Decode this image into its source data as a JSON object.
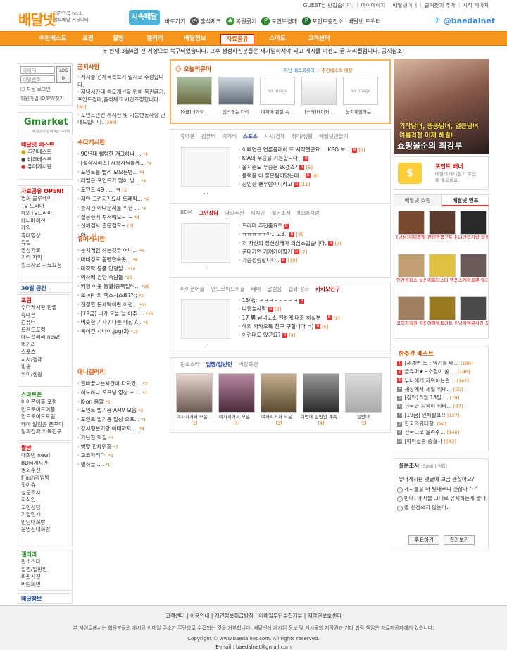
{
  "top_links": [
    "GUEST님 반갑습니다.",
    "마이페이지",
    "배달넷이니",
    "즐겨찾기 추가",
    "시작 페이지"
  ],
  "logo": {
    "text": "배달넷",
    "sub1": "대한민국 no.1",
    "sub2": "정보배달 커뮤니티",
    "badge": "시속배달"
  },
  "quicklinks": {
    "label": "바로가기",
    "items": [
      "출석체크",
      "복권긁기",
      "포인트경매",
      "포인트충전소",
      "배달넷 트위터!"
    ]
  },
  "twitter_handle": "@baedalnet",
  "nav": [
    "추천베스트",
    "포럼",
    "짤방",
    "갤러리",
    "배달정보",
    "자료공유",
    "스마트",
    "고객센터"
  ],
  "nav_active": "자료공유",
  "notice": "※ 현재 3월4일 전 게정으로 복구되었습니다. 그후 생성하신분들은 재가입하셔야 되고 게시물 이젠도 곧 처리될겁니다. 공지참조!",
  "login": {
    "id_placeholder": "아이디",
    "pw_placeholder": "비밀번호",
    "button": "LOG IN",
    "auto": "자동 로그인",
    "links": "회원가입 ID/PW찾기"
  },
  "gmarket": {
    "name": "Gmarket",
    "sub": "배달넷과 함께하는 G마켓"
  },
  "left_best": {
    "title": "배달넷 베스트",
    "items": [
      "추천베스트",
      "비추베스트",
      "유머게시판"
    ]
  },
  "left_share": {
    "title": "자료공유 OPEN!",
    "rows": [
      "영화 블루레이",
      "TV 드라마",
      "해외TV드라마",
      "애니메이션",
      "게임",
      "휴대영상",
      "유틸",
      "영상자료",
      "기타 자막",
      "링크자료 자료요청"
    ]
  },
  "left_30": "30일 공간",
  "left_forum": {
    "title": "포럼",
    "items": [
      "수다게시판 한줄",
      "휴대폰",
      "컴퓨터",
      "트랜드포럼",
      "애니갤러리 new!",
      "먹거리",
      "스포츠",
      "시사/경제",
      "방송",
      "취미/생활"
    ]
  },
  "left_smart": {
    "title": "스마트폰",
    "items": [
      "아이폰어플 포럼",
      "안드로이드어플",
      "안드로이드포럼",
      "테마 알림음 폰꾸미",
      "팁과강좌 카톡친구"
    ]
  },
  "left_jjal": {
    "title": "짤방",
    "items": [
      "대화방 new!",
      "BDM게시판",
      "영화추천",
      "Flash게임방",
      "핫이슈",
      "설문조사",
      "지식인",
      "고민상담",
      "기업인사",
      "만담대화방",
      "운영진대화방"
    ]
  },
  "left_gallery": {
    "title": "갤러리",
    "items": [
      "완소스타",
      "얼짱/일반인",
      "회원사진",
      "바탕화면"
    ]
  },
  "left_info": "배달정보",
  "notice_box": {
    "title": "공지사항",
    "items": [
      "게시물 전체목록보기 일시로 수정합니다.",
      "저녁시간대 속도개선을 위해 복권긁기,포인트경매,출석체크 시간조정합니다.",
      "포인트관련 게시판 및 기능변동사항 안내드립니다."
    ],
    "counts": [
      "[80]",
      "[80]",
      "[200]"
    ]
  },
  "free_board": {
    "title": "수다게시판",
    "items": [
      "90년대 썰렁한 개그하나 ...",
      "[철학시리즈] 사용자님들께...",
      "포인트를 빨리 모으는방...",
      "레벨은 포인트가 많이 쌓...",
      "포인트 49 ..... ㅋ",
      "저만 그런지? 요새 트래픽...",
      "송지선 아나운서를 위한 ...",
      "질문한거 투척해요~_~",
      "신체검사 결문검요~",
      "아~"
    ],
    "counts": [
      "*4",
      "*4",
      "*4",
      "*4",
      "*2",
      "*4",
      "*4",
      "*4",
      "[3]",
      "*1"
    ]
  },
  "humor_board": {
    "title": "유머게시판",
    "items": [
      "눈치게임 하는것두 어니...",
      "마네킹도 볼펜한속옷...",
      "마작막 등풀 인형탈..",
      "여자에 관란 속담들",
      "커핑 아웃 동결(중복일려...",
      "또 하나의 엑소시스트??;;",
      "진정한 돈세탁이란 이런...",
      "[19금] 내가 오늘 널 아주 ...",
      "비슷한 기사 / 다른 대상 /...",
      "목이긴 사나이.jpg(2)"
    ],
    "counts": [
      "*6",
      "*6",
      "*10",
      "*23",
      "*16",
      "*2",
      "*13",
      "*26",
      "*4",
      "*15"
    ]
  },
  "anime_gallery": {
    "title": "애니갤러리",
    "items": [
      "알바끝나는시간이 다되었...",
      "이노하나 오프닝 영상 + ...",
      "K-on 움짤",
      "포인트 벌기용 AMV 모음",
      "포인트 벌기용 일상 오프...",
      "강시형본기량 여태까지 ...",
      "가난한 덕질",
      "병맛 합체만화",
      "교코파티다.",
      "별하늘....."
    ],
    "counts": [
      "*2",
      "*2",
      "*5",
      "*3",
      "*1",
      "*4",
      "*3",
      "*7",
      "*1",
      "*1"
    ]
  },
  "today_humor": {
    "title": "오늘의유머",
    "links": [
      "지난 베스트유머",
      "추천베스트 예찰"
    ],
    "items": [
      "[9금]내가오...",
      "신박등는 다리",
      "여자에 관한 속...",
      "[스타]테이커...",
      "눈치게임하는..."
    ],
    "noimage": "No Image"
  },
  "tab_block1": {
    "tabs": [
      "휴대폰",
      "컴퓨터",
      "먹거리",
      "스포츠",
      "시사/경제",
      "취미/생활",
      "배달넷만들기"
    ],
    "active": "스포츠",
    "items": [
      "이빠연은 연론플레이 또 시작햇군요.!! KBO 보...",
      "KIA의 우승을 기원합니다!!",
      "올시즌도 우승은 sk겠죠?",
      "블랙을 아 좋은팀이었는데...",
      "잔인한 팬우람이니라고"
    ],
    "counts": [
      "[1]",
      "",
      "[5]",
      "[8]",
      "[11]"
    ]
  },
  "tab_block2": {
    "tabs": [
      "BDM",
      "고민상담",
      "영화추천",
      "지식인",
      "설문조사",
      "flash겜방"
    ],
    "active": "고민상담",
    "items": [
      "드라마 추천줌요!!",
      "ㅠㅠㅠㅠㅠ아.. 고3..",
      "저 자신의 정신상태가 의심스럽습니다.",
      "군대가면 가져가야할거",
      "가슴성형합니다.."
    ],
    "counts": [
      "",
      "[8]",
      "[3]",
      "[7]",
      "[10]"
    ]
  },
  "tab_block3": {
    "tabs": [
      "아이폰어플",
      "안드로이드어플",
      "테마",
      "알림음",
      "팁과 강좌",
      "카카오친구"
    ],
    "active": "카카오친구",
    "items": [
      "15여;; ㅋㅋㅋㅋㅋㅋㅋㅋ",
      "나랑놀사람",
      "17 男 남녀노소 편하게 대화 하실분~",
      "해외 카카오톡 친구 구합니다 =)",
      "이런대도 있군요?"
    ],
    "counts": [
      "",
      "[3]",
      "[2]",
      "[5]",
      "[4]"
    ]
  },
  "tab_block4": {
    "tabs": [
      "완소스타",
      "얼짱/일반인",
      "바탕화면"
    ],
    "active": "얼짱/일반인",
    "items": [
      "여자지거서 모은...",
      "여자지거서 모은...",
      "여자지거서 모은...",
      "이번에 일반인 계속...",
      "일반녀"
    ],
    "counts": [
      "[1]",
      "[1]",
      "[3]",
      "[4]",
      "[5]"
    ]
  },
  "ad_banner": {
    "line1": "키작남녀, 뚱뚱남녀, 얼큰남녀",
    "line1b": "여름걱정 이제 해결!",
    "line2": "쇼핑몰순의 최강루"
  },
  "point_banner": {
    "title": "포인트 배너",
    "sub": "배달넷 배너달고 포인트 쌓으세요."
  },
  "shop_tabs": [
    "배달넷 쇼핑",
    "배달넷 인포"
  ],
  "shop_items": [
    "[남성]새제품캐쥬얼슈즈",
    "현빈명품구두 판매율1위",
    "나만의가방 학생컬러3000",
    "인견원피스 늘씬한효과",
    "애프터스터 명품피아노",
    "스캐이트쁜 얼러겠어요",
    "코디지저권 지원기 사은품",
    "여혀빌트리트 휘파냅시",
    "남자얻분사진 모피면자"
  ],
  "week_best": {
    "title": "한주간 베스트",
    "items": [
      "[세계연 트 : 약기를 왜...",
      "금유머★~소질이 쏟 ...",
      "누나에게 자위하는걸...",
      "세상에서 제일 위대...",
      "[강좌] 5월 18일 ...",
      "천국과 지옥이 뒤바...",
      "[19금] 인체발표!!",
      "한국의위대함.",
      "천국으로 올려주...",
      "[하이실종 종결자"
    ],
    "counts": [
      "[180]",
      "[146]",
      "[167]",
      "[65]",
      "[79]",
      "[87]",
      "[127]",
      "[92]",
      "[140]",
      "[142]"
    ]
  },
  "survey": {
    "title": "설문조사",
    "subtitle": "(5point 적립)",
    "question": "유머게시판 댓글에 브금 괜찮아요?",
    "options": [
      "게시물을 더 빛내주니 괜찮다 ^^",
      "반대! 게시물 그대로 유지하는게 좋다.",
      "별 신경쓰지 않는다.."
    ],
    "vote": "투표하기",
    "result": "결과보기"
  },
  "footer": {
    "links": [
      "고객센터",
      "이용안내",
      "개인정보취급방침",
      "이메일무단수집거부",
      "저작권보호센터"
    ],
    "disclaimer": "본 사이트에서는 회원분들의 게시된 이메일 주소가 무단으로 수집되는 것을 거부합니다. 배달넷에 게시된 정보 및 게시물의 저작권과 기타 법적 책임은 자료제공자에게 있습니다.",
    "copyright": "Copyright © www.baedalnet.com. All rights reserved.",
    "email": "E-mail : baedalnet@gmail.com"
  },
  "colors": {
    "orange": "#f7941d",
    "red": "#d40000",
    "green": "#1a8a1a"
  }
}
